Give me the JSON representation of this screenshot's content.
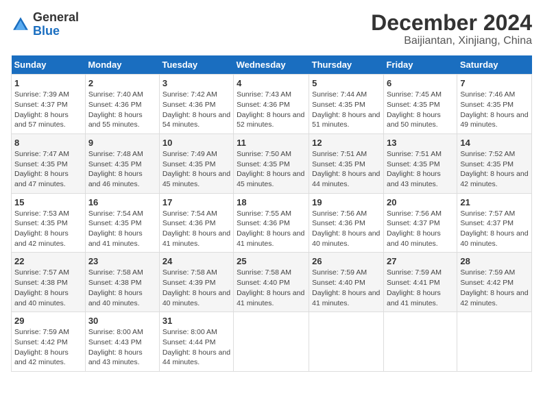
{
  "logo": {
    "general": "General",
    "blue": "Blue"
  },
  "header": {
    "month": "December 2024",
    "location": "Baijiantan, Xinjiang, China"
  },
  "days_of_week": [
    "Sunday",
    "Monday",
    "Tuesday",
    "Wednesday",
    "Thursday",
    "Friday",
    "Saturday"
  ],
  "weeks": [
    [
      {
        "day": "1",
        "sunrise": "Sunrise: 7:39 AM",
        "sunset": "Sunset: 4:37 PM",
        "daylight": "Daylight: 8 hours and 57 minutes."
      },
      {
        "day": "2",
        "sunrise": "Sunrise: 7:40 AM",
        "sunset": "Sunset: 4:36 PM",
        "daylight": "Daylight: 8 hours and 55 minutes."
      },
      {
        "day": "3",
        "sunrise": "Sunrise: 7:42 AM",
        "sunset": "Sunset: 4:36 PM",
        "daylight": "Daylight: 8 hours and 54 minutes."
      },
      {
        "day": "4",
        "sunrise": "Sunrise: 7:43 AM",
        "sunset": "Sunset: 4:36 PM",
        "daylight": "Daylight: 8 hours and 52 minutes."
      },
      {
        "day": "5",
        "sunrise": "Sunrise: 7:44 AM",
        "sunset": "Sunset: 4:35 PM",
        "daylight": "Daylight: 8 hours and 51 minutes."
      },
      {
        "day": "6",
        "sunrise": "Sunrise: 7:45 AM",
        "sunset": "Sunset: 4:35 PM",
        "daylight": "Daylight: 8 hours and 50 minutes."
      },
      {
        "day": "7",
        "sunrise": "Sunrise: 7:46 AM",
        "sunset": "Sunset: 4:35 PM",
        "daylight": "Daylight: 8 hours and 49 minutes."
      }
    ],
    [
      {
        "day": "8",
        "sunrise": "Sunrise: 7:47 AM",
        "sunset": "Sunset: 4:35 PM",
        "daylight": "Daylight: 8 hours and 47 minutes."
      },
      {
        "day": "9",
        "sunrise": "Sunrise: 7:48 AM",
        "sunset": "Sunset: 4:35 PM",
        "daylight": "Daylight: 8 hours and 46 minutes."
      },
      {
        "day": "10",
        "sunrise": "Sunrise: 7:49 AM",
        "sunset": "Sunset: 4:35 PM",
        "daylight": "Daylight: 8 hours and 45 minutes."
      },
      {
        "day": "11",
        "sunrise": "Sunrise: 7:50 AM",
        "sunset": "Sunset: 4:35 PM",
        "daylight": "Daylight: 8 hours and 45 minutes."
      },
      {
        "day": "12",
        "sunrise": "Sunrise: 7:51 AM",
        "sunset": "Sunset: 4:35 PM",
        "daylight": "Daylight: 8 hours and 44 minutes."
      },
      {
        "day": "13",
        "sunrise": "Sunrise: 7:51 AM",
        "sunset": "Sunset: 4:35 PM",
        "daylight": "Daylight: 8 hours and 43 minutes."
      },
      {
        "day": "14",
        "sunrise": "Sunrise: 7:52 AM",
        "sunset": "Sunset: 4:35 PM",
        "daylight": "Daylight: 8 hours and 42 minutes."
      }
    ],
    [
      {
        "day": "15",
        "sunrise": "Sunrise: 7:53 AM",
        "sunset": "Sunset: 4:35 PM",
        "daylight": "Daylight: 8 hours and 42 minutes."
      },
      {
        "day": "16",
        "sunrise": "Sunrise: 7:54 AM",
        "sunset": "Sunset: 4:35 PM",
        "daylight": "Daylight: 8 hours and 41 minutes."
      },
      {
        "day": "17",
        "sunrise": "Sunrise: 7:54 AM",
        "sunset": "Sunset: 4:36 PM",
        "daylight": "Daylight: 8 hours and 41 minutes."
      },
      {
        "day": "18",
        "sunrise": "Sunrise: 7:55 AM",
        "sunset": "Sunset: 4:36 PM",
        "daylight": "Daylight: 8 hours and 41 minutes."
      },
      {
        "day": "19",
        "sunrise": "Sunrise: 7:56 AM",
        "sunset": "Sunset: 4:36 PM",
        "daylight": "Daylight: 8 hours and 40 minutes."
      },
      {
        "day": "20",
        "sunrise": "Sunrise: 7:56 AM",
        "sunset": "Sunset: 4:37 PM",
        "daylight": "Daylight: 8 hours and 40 minutes."
      },
      {
        "day": "21",
        "sunrise": "Sunrise: 7:57 AM",
        "sunset": "Sunset: 4:37 PM",
        "daylight": "Daylight: 8 hours and 40 minutes."
      }
    ],
    [
      {
        "day": "22",
        "sunrise": "Sunrise: 7:57 AM",
        "sunset": "Sunset: 4:38 PM",
        "daylight": "Daylight: 8 hours and 40 minutes."
      },
      {
        "day": "23",
        "sunrise": "Sunrise: 7:58 AM",
        "sunset": "Sunset: 4:38 PM",
        "daylight": "Daylight: 8 hours and 40 minutes."
      },
      {
        "day": "24",
        "sunrise": "Sunrise: 7:58 AM",
        "sunset": "Sunset: 4:39 PM",
        "daylight": "Daylight: 8 hours and 40 minutes."
      },
      {
        "day": "25",
        "sunrise": "Sunrise: 7:58 AM",
        "sunset": "Sunset: 4:40 PM",
        "daylight": "Daylight: 8 hours and 41 minutes."
      },
      {
        "day": "26",
        "sunrise": "Sunrise: 7:59 AM",
        "sunset": "Sunset: 4:40 PM",
        "daylight": "Daylight: 8 hours and 41 minutes."
      },
      {
        "day": "27",
        "sunrise": "Sunrise: 7:59 AM",
        "sunset": "Sunset: 4:41 PM",
        "daylight": "Daylight: 8 hours and 41 minutes."
      },
      {
        "day": "28",
        "sunrise": "Sunrise: 7:59 AM",
        "sunset": "Sunset: 4:42 PM",
        "daylight": "Daylight: 8 hours and 42 minutes."
      }
    ],
    [
      {
        "day": "29",
        "sunrise": "Sunrise: 7:59 AM",
        "sunset": "Sunset: 4:42 PM",
        "daylight": "Daylight: 8 hours and 42 minutes."
      },
      {
        "day": "30",
        "sunrise": "Sunrise: 8:00 AM",
        "sunset": "Sunset: 4:43 PM",
        "daylight": "Daylight: 8 hours and 43 minutes."
      },
      {
        "day": "31",
        "sunrise": "Sunrise: 8:00 AM",
        "sunset": "Sunset: 4:44 PM",
        "daylight": "Daylight: 8 hours and 44 minutes."
      },
      null,
      null,
      null,
      null
    ]
  ]
}
